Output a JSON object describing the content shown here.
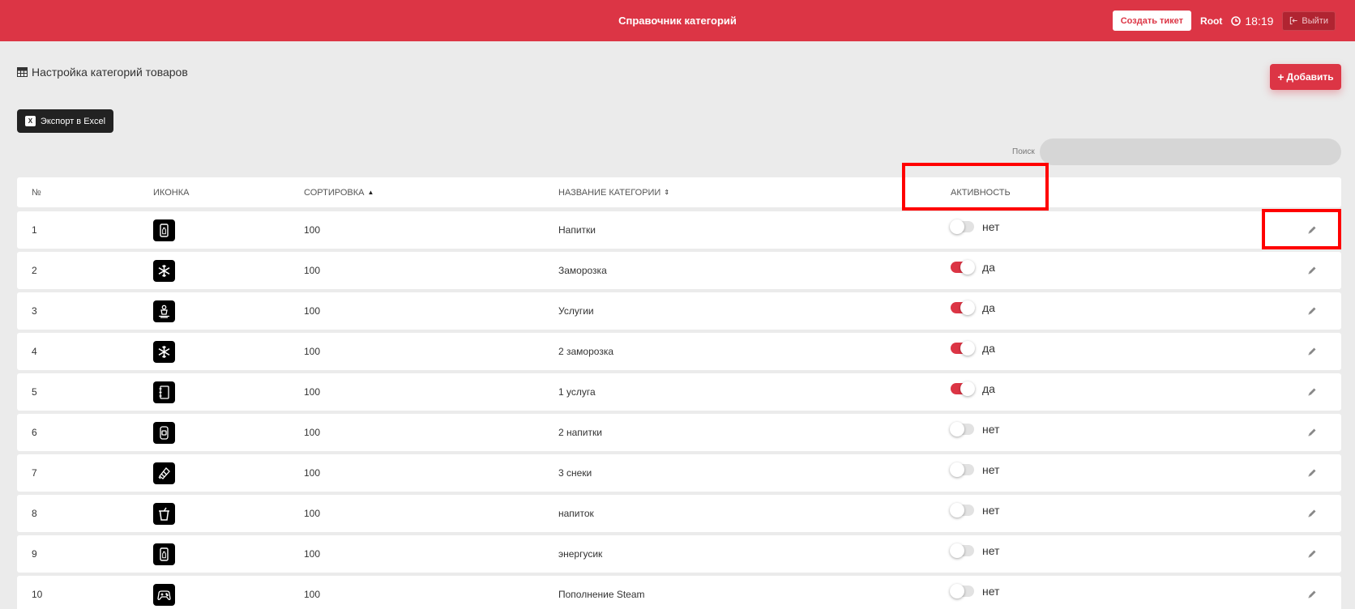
{
  "header": {
    "title": "Справочник категорий",
    "ticket_button": "Создать тикет",
    "user": "Root",
    "time": "18:19",
    "logout_button": "Выйти"
  },
  "page": {
    "title": "Настройка категорий товаров",
    "add_button": "Добавить",
    "export_button": "Экспорт в Excel",
    "search_label": "Поиск",
    "search_value": ""
  },
  "table": {
    "columns": {
      "num": "№",
      "icon": "ИКОНКА",
      "sort": "СОРТИРОВКА",
      "name": "НАЗВАНИЕ КАТЕГОРИИ",
      "active": "АКТИВНОСТЬ"
    },
    "rows": [
      {
        "num": "1",
        "icon": "phone-bottle-icon",
        "sort": "100",
        "name": "Напитки",
        "active": false,
        "active_label": "нет"
      },
      {
        "num": "2",
        "icon": "snowflake-icon",
        "sort": "100",
        "name": "Заморозка",
        "active": true,
        "active_label": "да"
      },
      {
        "num": "3",
        "icon": "service-person-icon",
        "sort": "100",
        "name": "Услугии",
        "active": true,
        "active_label": "да"
      },
      {
        "num": "4",
        "icon": "snowflake-icon",
        "sort": "100",
        "name": "2 заморозка",
        "active": true,
        "active_label": "да"
      },
      {
        "num": "5",
        "icon": "notebook-icon",
        "sort": "100",
        "name": "1 услуга",
        "active": true,
        "active_label": "да"
      },
      {
        "num": "6",
        "icon": "can-icon",
        "sort": "100",
        "name": "2 напитки",
        "active": false,
        "active_label": "нет"
      },
      {
        "num": "7",
        "icon": "snack-bar-icon",
        "sort": "100",
        "name": "3 снеки",
        "active": false,
        "active_label": "нет"
      },
      {
        "num": "8",
        "icon": "cup-icon",
        "sort": "100",
        "name": "напиток",
        "active": false,
        "active_label": "нет"
      },
      {
        "num": "9",
        "icon": "phone-bottle-icon",
        "sort": "100",
        "name": "энергусик",
        "active": false,
        "active_label": "нет"
      },
      {
        "num": "10",
        "icon": "gamepad-icon",
        "sort": "100",
        "name": "Пополнение Steam",
        "active": false,
        "active_label": "нет"
      }
    ]
  },
  "colors": {
    "accent": "#dc3545",
    "background": "#ebebeb",
    "highlight": "#ff0000"
  }
}
